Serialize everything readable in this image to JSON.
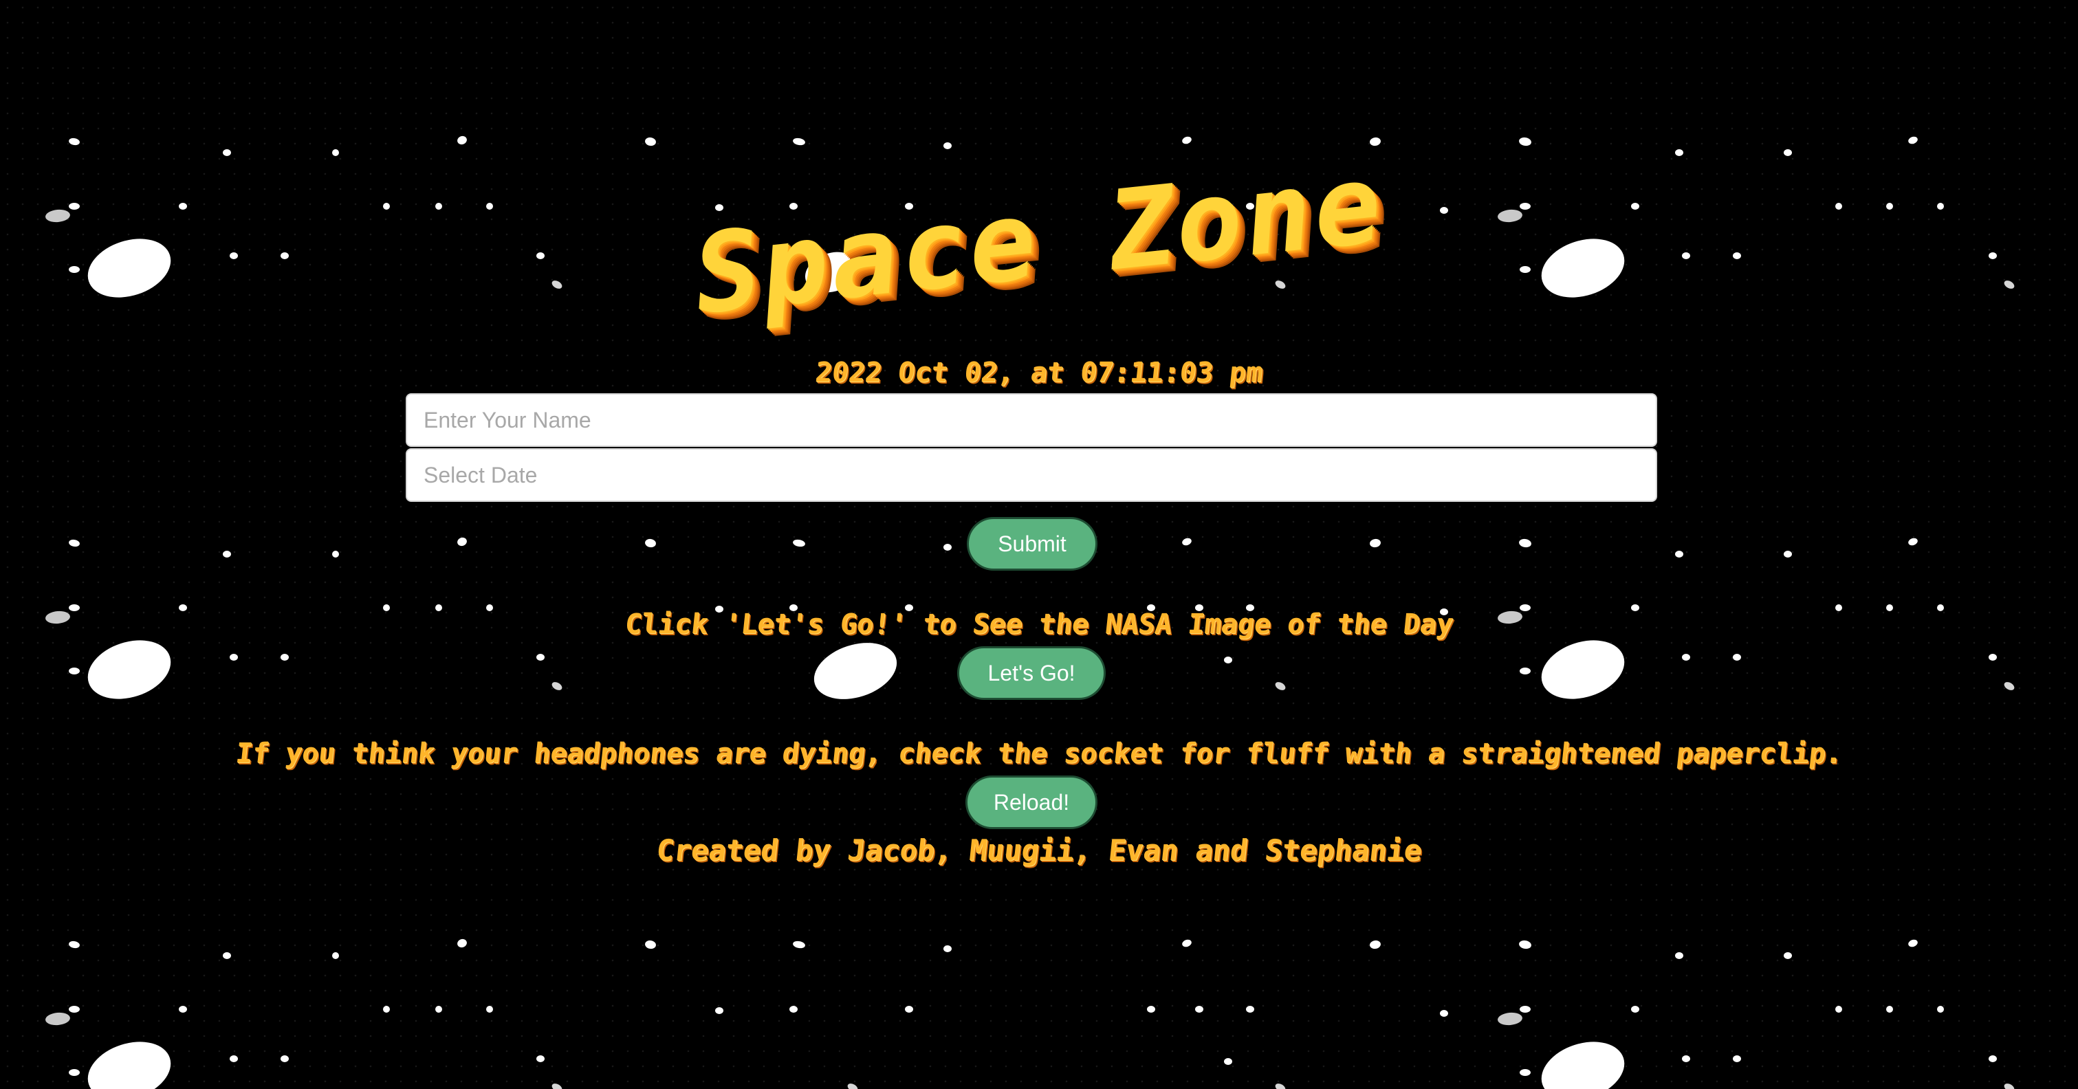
{
  "header": {
    "title": "Space Zone"
  },
  "datetime": {
    "display": "2022 Oct 02, at 07:11:03 pm"
  },
  "form": {
    "name_placeholder": "Enter Your Name",
    "date_placeholder": "Select Date",
    "submit_label": "Submit"
  },
  "apod": {
    "hint": "Click 'Let's Go!' to See the NASA Image of the Day",
    "button_label": "Let's Go!"
  },
  "tip": {
    "text": "If you think your headphones are dying, check the socket for fluff with a straightened paperclip.",
    "reload_label": "Reload!"
  },
  "footer": {
    "credits": "Created by Jacob, Muugii, Evan and Stephanie"
  },
  "colors": {
    "background": "#000000",
    "title": "#ffd43a",
    "text": "#ffb52a",
    "button": "#5ab37f",
    "button_border": "#1e4d33",
    "star": "#ffffff"
  }
}
